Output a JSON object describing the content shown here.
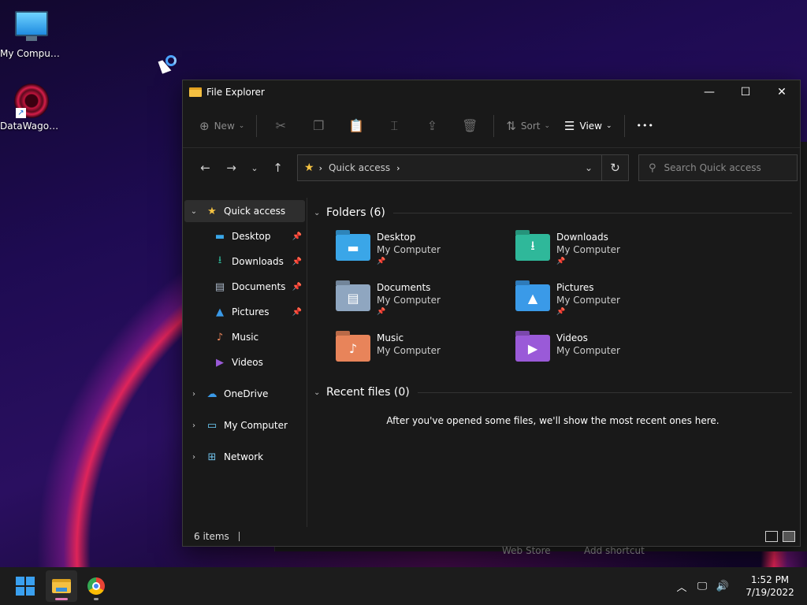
{
  "desktop": {
    "icons": [
      {
        "label": "My Computer",
        "icon": "monitor-icon"
      },
      {
        "label": "DataWagon...",
        "icon": "datawagon-shortcut-icon"
      }
    ]
  },
  "back_window": {
    "text1": "Web Store",
    "text2": "Add shortcut"
  },
  "explorer": {
    "title": "File Explorer",
    "controls": {
      "minimize": "—",
      "maximize": "☐",
      "close": "✕"
    },
    "toolbar": {
      "new_label": "New",
      "sort_label": "Sort",
      "view_label": "View",
      "more_label": "•••"
    },
    "address": {
      "location": "Quick access",
      "search_placeholder": "Search Quick access"
    },
    "sidebar": {
      "quick_access": "Quick access",
      "children": [
        {
          "label": "Desktop",
          "pinned": true
        },
        {
          "label": "Downloads",
          "pinned": true
        },
        {
          "label": "Documents",
          "pinned": true
        },
        {
          "label": "Pictures",
          "pinned": true
        },
        {
          "label": "Music",
          "pinned": false
        },
        {
          "label": "Videos",
          "pinned": false
        }
      ],
      "roots": [
        {
          "label": "OneDrive"
        },
        {
          "label": "My Computer"
        },
        {
          "label": "Network"
        }
      ]
    },
    "folders_header": "Folders (6)",
    "folders": [
      {
        "name": "Desktop",
        "location": "My Computer",
        "color": "#3aa6e8",
        "pinned": true
      },
      {
        "name": "Downloads",
        "location": "My Computer",
        "color": "#2fb89a",
        "pinned": true
      },
      {
        "name": "Documents",
        "location": "My Computer",
        "color": "#8fa6c0",
        "pinned": true
      },
      {
        "name": "Pictures",
        "location": "My Computer",
        "color": "#3a9ae8",
        "pinned": true
      },
      {
        "name": "Music",
        "location": "My Computer",
        "color": "#e8845a",
        "pinned": false
      },
      {
        "name": "Videos",
        "location": "My Computer",
        "color": "#9a5ad8",
        "pinned": false
      }
    ],
    "recent_header": "Recent files (0)",
    "recent_message": "After you've opened some files, we'll show the most recent ones here.",
    "status": {
      "items": "6 items"
    }
  },
  "taskbar": {
    "clock_time": "1:52 PM",
    "clock_date": "7/19/2022"
  }
}
